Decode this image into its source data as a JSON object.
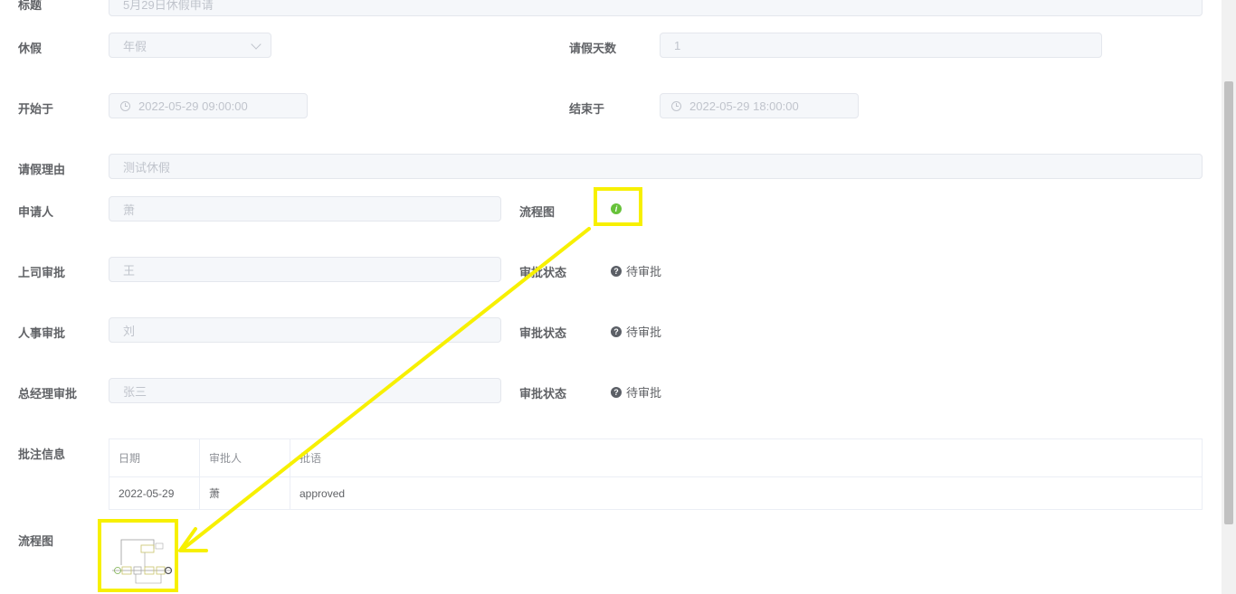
{
  "form": {
    "title_label": "标题",
    "title_value": "5月29日休假申请",
    "leave_type_label": "休假",
    "leave_type_value": "年假",
    "days_label": "请假天数",
    "days_value": "1",
    "start_label": "开始于",
    "start_value": "2022-05-29 09:00:00",
    "end_label": "结束于",
    "end_value": "2022-05-29 18:00:00",
    "reason_label": "请假理由",
    "reason_value": "测试休假",
    "applicant_label": "申请人",
    "applicant_value": "萧",
    "flowchart_label": "流程图",
    "info_icon_glyph": "i",
    "manager_label": "上司审批",
    "manager_value": "王",
    "hr_label": "人事审批",
    "hr_value": "刘",
    "gm_label": "总经理审批",
    "gm_value": "张三",
    "status_label": "审批状态",
    "status_value": "待审批",
    "status_icon_glyph": "?",
    "comments_label": "批注信息",
    "flowchart_bottom_label": "流程图"
  },
  "comments": {
    "headers": [
      "日期",
      "审批人",
      "批语"
    ],
    "rows": [
      [
        "2022-05-29",
        "萧",
        "approved"
      ]
    ]
  },
  "colors": {
    "highlight": "#f7f000",
    "info_icon": "#67c23a",
    "status_icon": "#5b5f66"
  }
}
